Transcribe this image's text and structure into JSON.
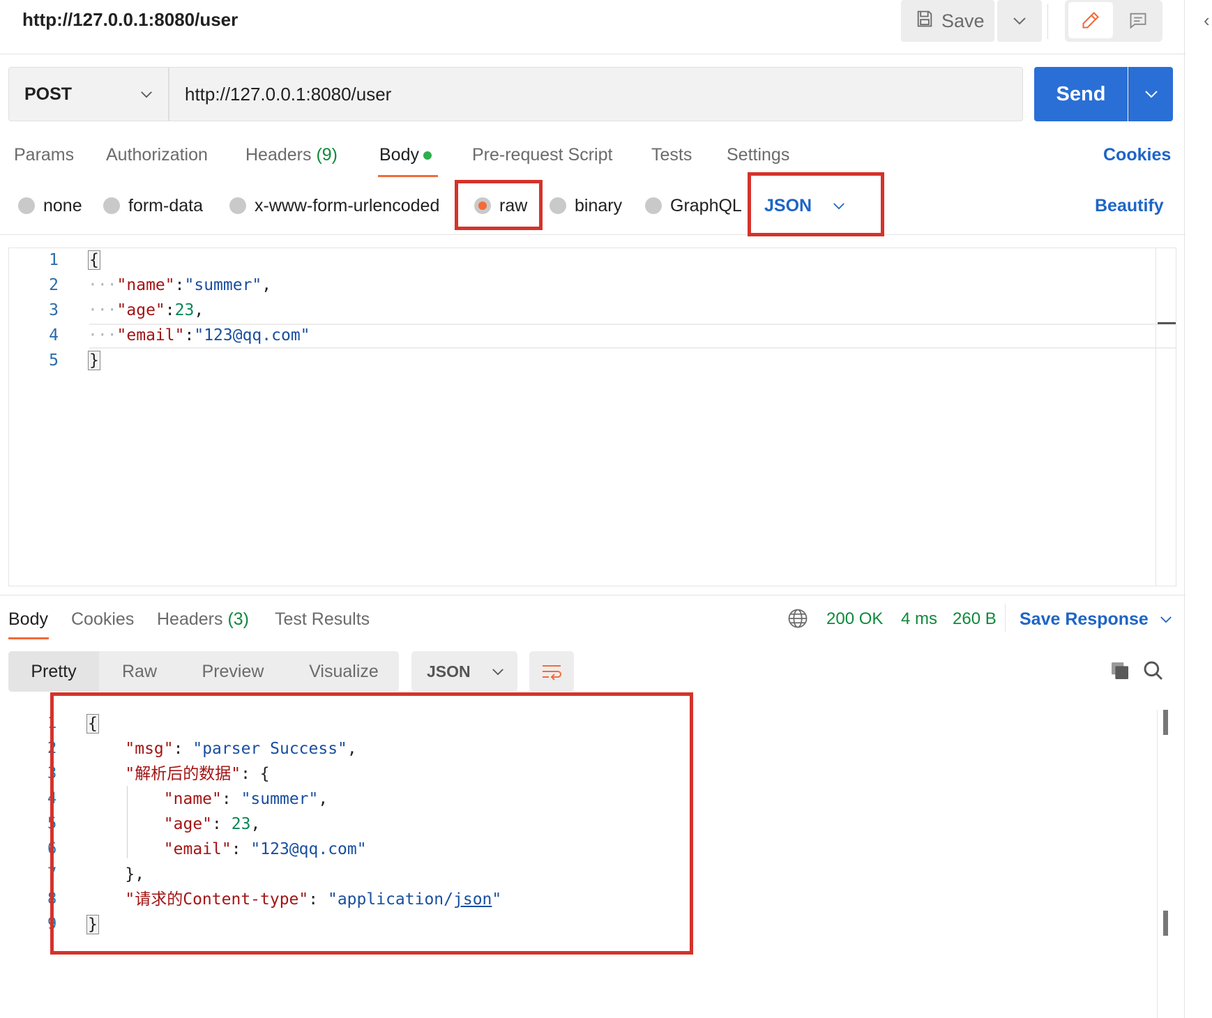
{
  "header": {
    "title": "http://127.0.0.1:8080/user",
    "save_label": "Save"
  },
  "request": {
    "method": "POST",
    "url": "http://127.0.0.1:8080/user",
    "send_label": "Send"
  },
  "request_tabs": {
    "params": "Params",
    "authorization": "Authorization",
    "headers": "Headers",
    "headers_count": "(9)",
    "body": "Body",
    "pre_request": "Pre-request Script",
    "tests": "Tests",
    "settings": "Settings",
    "cookies": "Cookies"
  },
  "body_types": {
    "none": "none",
    "form_data": "form-data",
    "urlencoded": "x-www-form-urlencoded",
    "raw": "raw",
    "binary": "binary",
    "graphql": "GraphQL",
    "language": "JSON",
    "beautify": "Beautify"
  },
  "request_editor": {
    "line_numbers": [
      "1",
      "2",
      "3",
      "4",
      "5"
    ],
    "open": "{",
    "close": "}",
    "indent": "···",
    "key1": "\"name\"",
    "val1": "\"summer\"",
    "key2": "\"age\"",
    "val2": "23",
    "key3": "\"email\"",
    "val3": "\"123@qq.com\""
  },
  "response_tabs": {
    "body": "Body",
    "cookies": "Cookies",
    "headers": "Headers",
    "headers_count": "(3)",
    "test_results": "Test Results"
  },
  "response_status": {
    "status": "200 OK",
    "time": "4 ms",
    "size": "260 B",
    "save_response": "Save Response"
  },
  "response_view": {
    "pretty": "Pretty",
    "raw": "Raw",
    "preview": "Preview",
    "visualize": "Visualize",
    "format": "JSON"
  },
  "response_body": {
    "line_numbers": [
      "1",
      "2",
      "3",
      "4",
      "5",
      "6",
      "7",
      "8",
      "9"
    ],
    "open": "{",
    "close": "}",
    "msg_key": "\"msg\"",
    "msg_val": "\"parser Success\"",
    "parsed_key": "\"解析后的数据\"",
    "name_key": "\"name\"",
    "name_val": "\"summer\"",
    "age_key": "\"age\"",
    "age_val": "23",
    "email_key": "\"email\"",
    "email_val": "\"123@qq.com\"",
    "inner_close": "},",
    "ctype_key": "\"请求的Content-type\"",
    "ctype_val_a": "application/",
    "ctype_val_b": "json"
  },
  "colors": {
    "accent_orange": "#f26b3a",
    "send_blue": "#2a6fd6",
    "link_blue": "#1e65c6",
    "status_green": "#0f8a3c",
    "highlight_red": "#d4332a"
  },
  "icons": [
    "save-icon",
    "chevron-down-icon",
    "pencil-icon",
    "comment-icon",
    "globe-icon",
    "wrap-lines-icon",
    "copy-icon",
    "search-icon"
  ]
}
